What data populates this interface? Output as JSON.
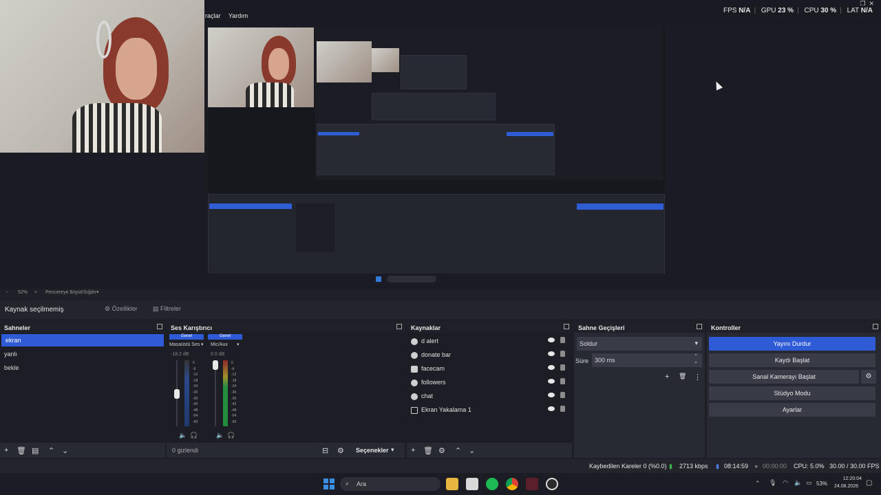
{
  "menu": [
    "raçlar",
    "Yardım"
  ],
  "stats": {
    "fps_label": "FPS",
    "fps": "N/A",
    "gpu_label": "GPU",
    "gpu": "23 %",
    "cpu_label": "CPU",
    "cpu": "30 %",
    "lat_label": "LAT",
    "lat": "N/A"
  },
  "zoom": {
    "minus": "−",
    "value": "52%",
    "plus": "+",
    "fit": "Pencereye Büyüt/Sığdır"
  },
  "source_bar": {
    "no_source": "Kaynak seçilmemiş",
    "properties": "Özellikler",
    "filters": "Filtreler"
  },
  "scenes": {
    "title": "Sahneler",
    "items": [
      "ekran",
      "yanlı",
      "bekle"
    ],
    "selected": 0
  },
  "mixer": {
    "title": "Ses Karıştırıcı",
    "channels": [
      {
        "tab": "Genel",
        "name": "Masaüstü Ses",
        "db": "-18.2 dB",
        "level": 0.3
      },
      {
        "tab": "Genel",
        "name": "Mic/Aux",
        "db": "0.0 dB",
        "level": 0.9
      }
    ],
    "ticks": [
      "0",
      "-6",
      "-12",
      "-18",
      "-24",
      "-30",
      "-36",
      "-42",
      "-48",
      "-54",
      "-60"
    ],
    "hidden": "0 gizlendi",
    "options": "Seçenekler"
  },
  "sources": {
    "title": "Kaynaklar",
    "items": [
      {
        "name": "d alert",
        "icon": "globe-icon"
      },
      {
        "name": "donate bar",
        "icon": "globe-icon"
      },
      {
        "name": "facecam",
        "icon": "camera-icon"
      },
      {
        "name": "followers",
        "icon": "globe-icon"
      },
      {
        "name": "chat",
        "icon": "globe-icon"
      },
      {
        "name": "Ekran Yakalama 1",
        "icon": "monitor-icon"
      }
    ]
  },
  "transitions": {
    "title": "Sahne Geçişleri",
    "type": "Soldur",
    "duration_label": "Süre",
    "duration": "300 ms"
  },
  "controls": {
    "title": "Kontroller",
    "buttons": [
      "Yayını Durdur",
      "Kaydı Başlat",
      "Sanal Kamerayı Başlat",
      "Stüdyo Modu",
      "Ayarlar"
    ]
  },
  "status": {
    "dropped": "Kaybedilen Kareler 0 (%0.0)",
    "bitrate": "2713 kbps",
    "stream_time": "08:14:59",
    "rec_time": "00:00:00",
    "cpu": "CPU: 5.0%",
    "fps": "30.00 / 30.00 FPS"
  },
  "taskbar": {
    "search": "Ara",
    "battery": "53%",
    "time": "12:20:04",
    "date": "24.08.2026"
  },
  "colors": {
    "accent": "#2f5bd6",
    "panel": "#272933",
    "bg": "#1d1e25"
  }
}
